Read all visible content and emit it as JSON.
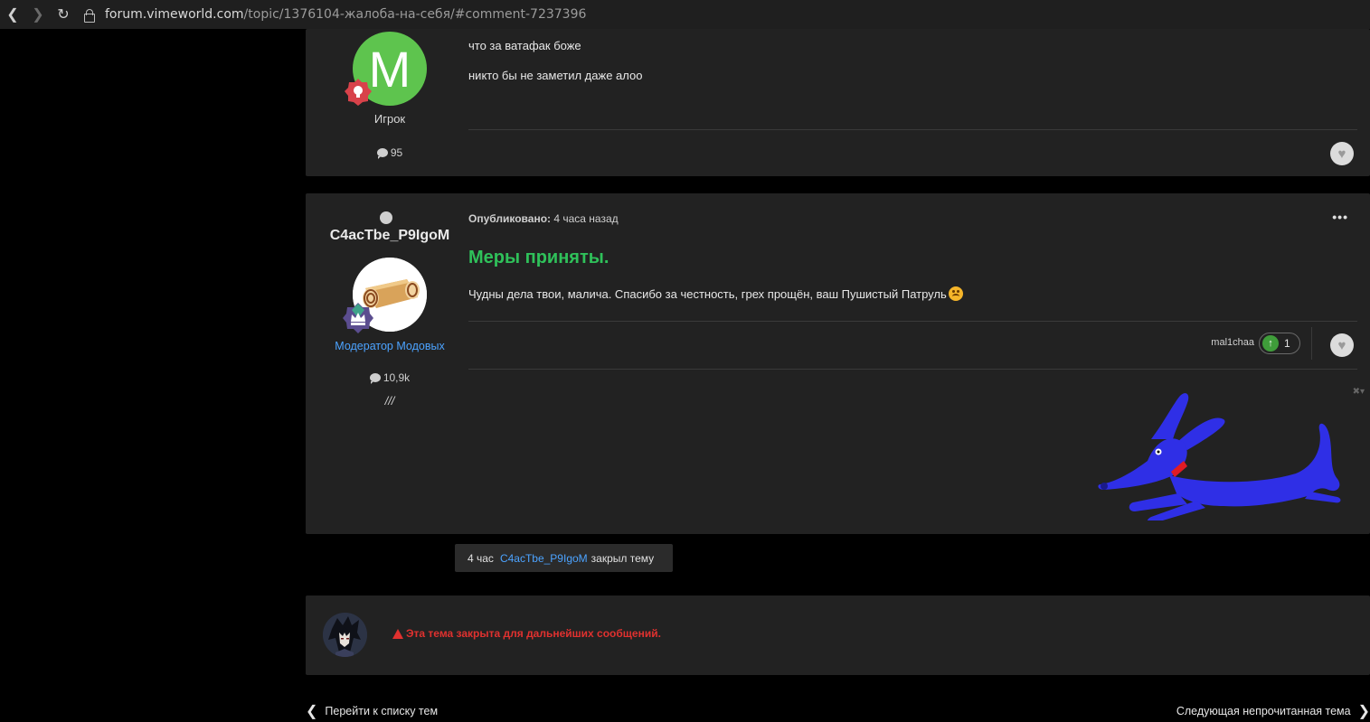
{
  "browser": {
    "back_icon": "chevron-left-icon",
    "forward_icon": "chevron-right-icon",
    "reload_icon": "reload-icon",
    "url_host": "forum.vimeworld.com",
    "url_path": "/topic/1376104-жалоба-на-себя/#comment-7237396"
  },
  "post1": {
    "avatar_letter": "M",
    "avatar_color": "#5ec44e",
    "rank": "Игрок",
    "post_count": "95",
    "lines": [
      "что за ватафак боже",
      "никто бы не заметил даже алоо"
    ]
  },
  "post2": {
    "username": "C4acTbe_P9IgoM",
    "group": "Модератор Модовых",
    "post_count": "10,9k",
    "signature": "///",
    "meta_label": "Опубликовано:",
    "meta_time": "4 часа назад",
    "heading": "Меры приняты.",
    "body": "Чудны дела твои, малича. Спасибо за честность, грех прощён, ваш Пушистый Патруль",
    "reaction_user": "mal1chaa",
    "reaction_count": "1",
    "heading_color": "#2fc15a"
  },
  "event": {
    "time": "4 час",
    "user": "C4acTbe_P9IgoM",
    "action": "закрыл тему"
  },
  "closed": {
    "message": "Эта тема закрыта для дальнейших сообщений."
  },
  "bottom_nav": {
    "prev": "Перейти к списку тем",
    "next": "Следующая непрочитанная тема"
  }
}
